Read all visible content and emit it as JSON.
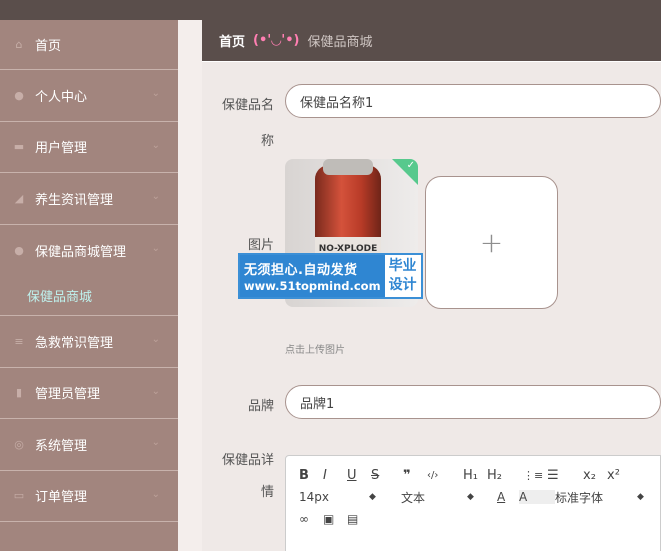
{
  "sidebar": {
    "items": [
      {
        "label": "首页",
        "icon": "home-icon",
        "glyph": "⌂",
        "chev": ""
      },
      {
        "label": "个人中心",
        "icon": "user-icon",
        "glyph": "●",
        "chev": "⌄"
      },
      {
        "label": "用户管理",
        "icon": "monitor-icon",
        "glyph": "▬",
        "chev": "⌄"
      },
      {
        "label": "养生资讯管理",
        "icon": "news-icon",
        "glyph": "◢",
        "chev": "⌄"
      },
      {
        "label": "保健品商城管理",
        "icon": "person-icon",
        "glyph": "●",
        "chev": "⌄"
      },
      {
        "label": "急救常识管理",
        "icon": "list-icon",
        "glyph": "≡",
        "chev": "⌄"
      },
      {
        "label": "管理员管理",
        "icon": "bar-chart-icon",
        "glyph": "▮",
        "chev": "⌄"
      },
      {
        "label": "系统管理",
        "icon": "gear-icon",
        "glyph": "◎",
        "chev": "⌄"
      },
      {
        "label": "订单管理",
        "icon": "document-icon",
        "glyph": "▭",
        "chev": "⌄"
      }
    ],
    "sub_item": "保健品商城"
  },
  "breadcrumb": {
    "home": "首页",
    "emoji": "(•'◡'•)",
    "current": "保健品商城"
  },
  "form": {
    "name_label_1": "保健品名",
    "name_label_2": "称",
    "name_value": "保健品名称1",
    "image_label": "图片",
    "upload_plus": "+",
    "upload_hint": "点击上传图片",
    "brand_label": "品牌",
    "brand_value": "品牌1",
    "detail_label_1": "保健品详",
    "detail_label_2": "情"
  },
  "product_image": {
    "stripe_text": "NO-XPLODE"
  },
  "watermark": {
    "line1": "无须担心.自动发货",
    "line2": "www.51topmind.com",
    "right1": "毕业",
    "right2": "设计"
  },
  "editor": {
    "row1": [
      "B",
      "I",
      "U",
      "S",
      "❞",
      "‹/›",
      "H₁",
      "H₂",
      "⋮≡",
      "☰",
      "x₂",
      "x²"
    ],
    "font_size": "14px",
    "font_type": "文本",
    "font_family": "标准字体",
    "row3": [
      "link-icon",
      "image-icon",
      "video-icon"
    ]
  },
  "colors": {
    "sidebar_bg": "#a2857e",
    "topbar_bg": "#5a4e4b",
    "sub_item": "#bff2ee",
    "emoji": "#ff7fb2",
    "watermark_blue": "#2f86d2",
    "success_green": "#57c98d"
  }
}
